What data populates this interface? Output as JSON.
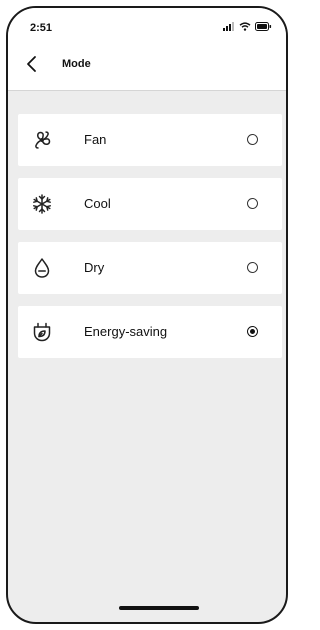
{
  "status_bar": {
    "time": "2:51"
  },
  "nav": {
    "title": "Mode"
  },
  "modes": [
    {
      "label": "Fan",
      "icon": "fan-icon",
      "selected": false
    },
    {
      "label": "Cool",
      "icon": "snowflake-icon",
      "selected": false
    },
    {
      "label": "Dry",
      "icon": "droplet-icon",
      "selected": false
    },
    {
      "label": "Energy-saving",
      "icon": "leaf-plug-icon",
      "selected": true
    }
  ]
}
